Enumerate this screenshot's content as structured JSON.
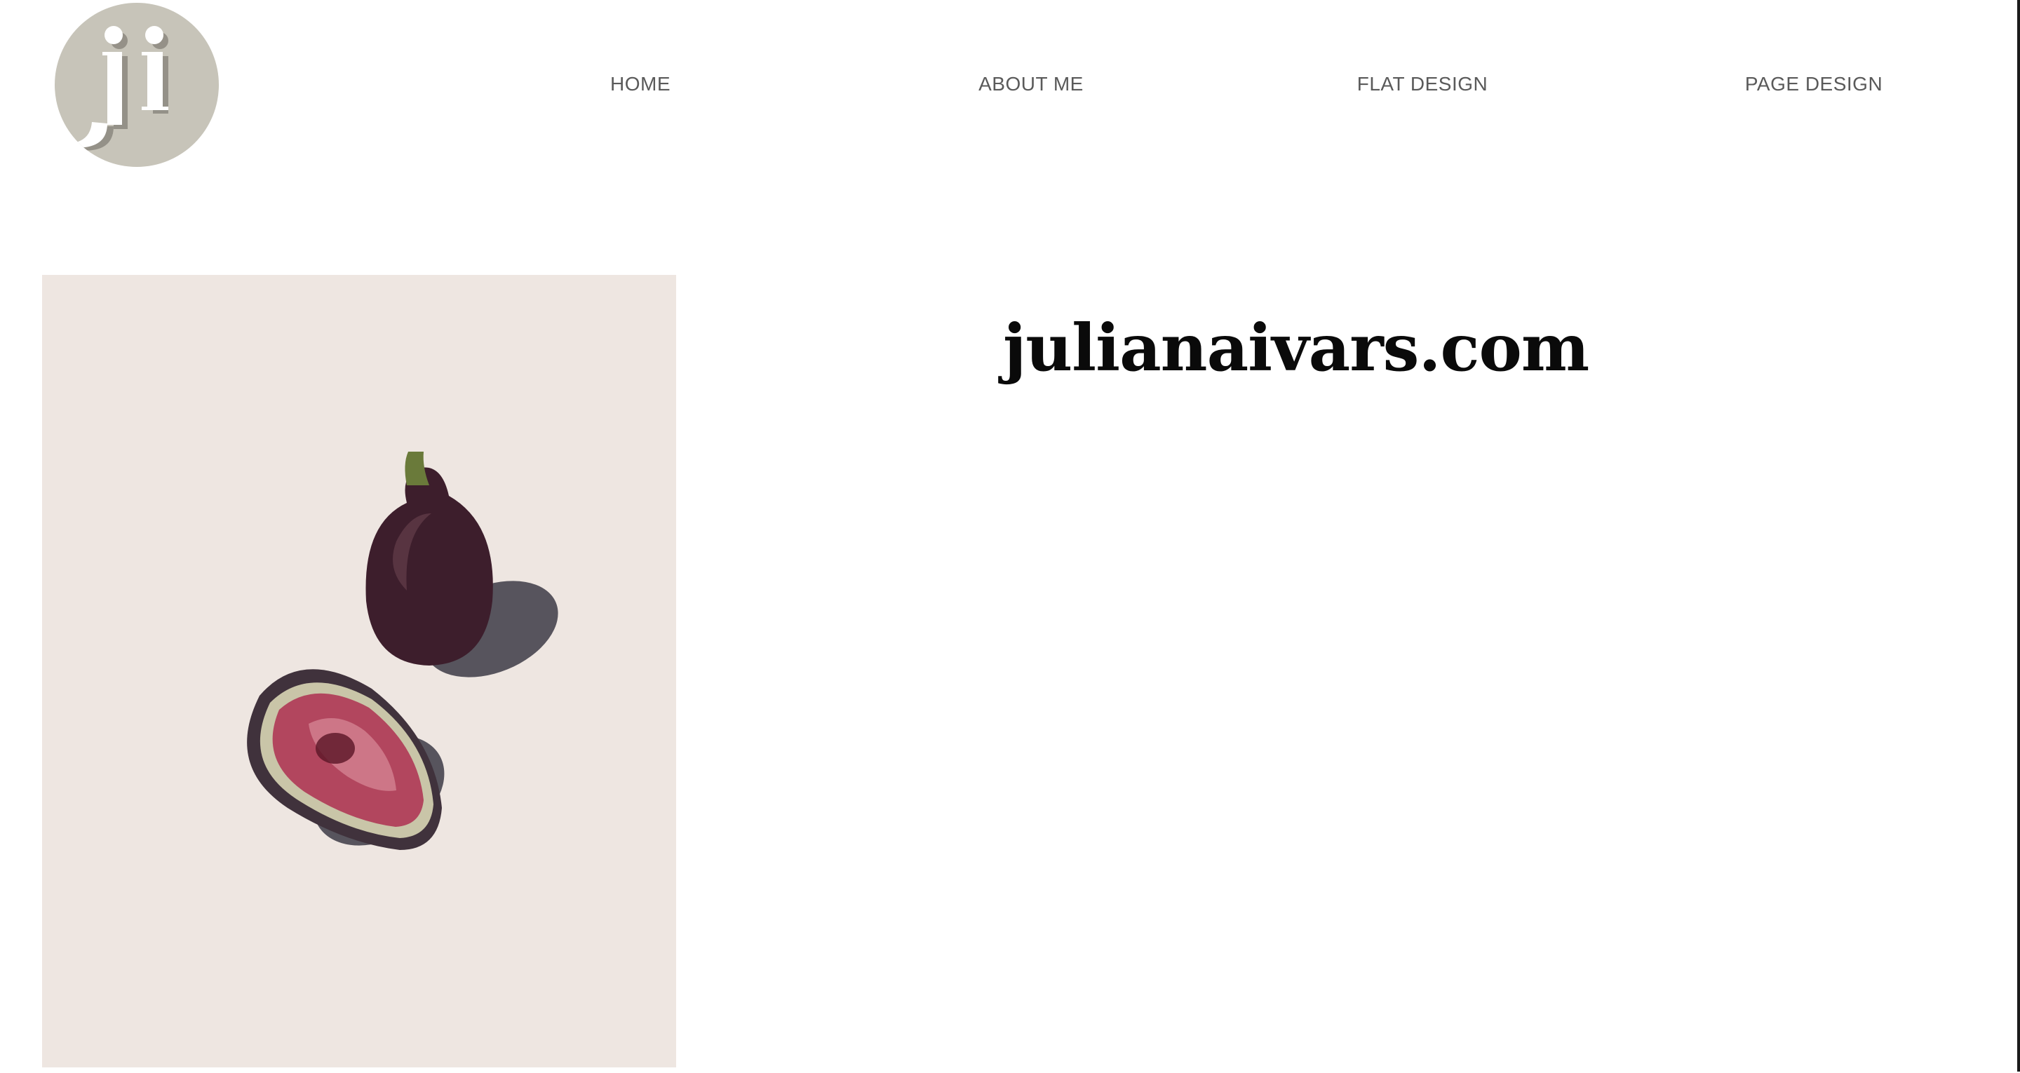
{
  "logo": {
    "text": "ji",
    "bg_color": "#c7c4b9"
  },
  "nav": {
    "items": [
      {
        "label": "HOME"
      },
      {
        "label": "ABOUT ME"
      },
      {
        "label": "FLAT DESIGN"
      },
      {
        "label": "PAGE DESIGN"
      }
    ]
  },
  "hero": {
    "title": "julianaivars.com",
    "image_subject": "figs",
    "image_bg_color": "#eee6e1"
  },
  "colors": {
    "nav_text": "#5a5a5a",
    "title_text": "#0a0a0a",
    "page_bg": "#ffffff"
  }
}
